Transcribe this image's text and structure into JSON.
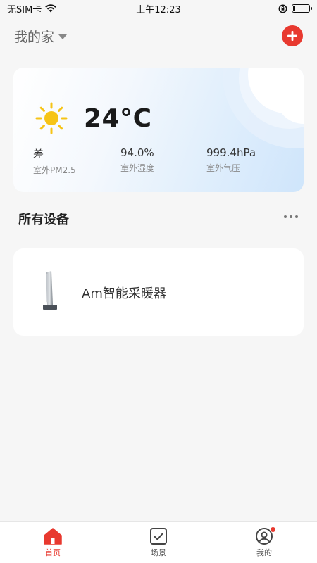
{
  "status_bar": {
    "carrier": "无SIM卡",
    "time": "上午12:23",
    "battery_level": 0.15
  },
  "header": {
    "home_name": "我的家",
    "add_icon": "plus-icon",
    "accent_color": "#e8392f"
  },
  "weather": {
    "icon": "sun-icon",
    "temperature": "24°C",
    "stats": [
      {
        "value": "差",
        "label": "室外PM2.5"
      },
      {
        "value": "94.0%",
        "label": "室外湿度"
      },
      {
        "value": "999.4hPa",
        "label": "室外气压"
      }
    ]
  },
  "devices_section": {
    "title": "所有设备",
    "more_icon": "more-dots-icon",
    "devices": [
      {
        "name": "Am智能采暖器",
        "icon": "heater-icon"
      }
    ]
  },
  "tab_bar": {
    "tabs": [
      {
        "label": "首页",
        "icon": "home-icon",
        "active": true
      },
      {
        "label": "场景",
        "icon": "scene-check-icon",
        "active": false
      },
      {
        "label": "我的",
        "icon": "profile-icon",
        "active": false,
        "badge": true
      }
    ]
  }
}
